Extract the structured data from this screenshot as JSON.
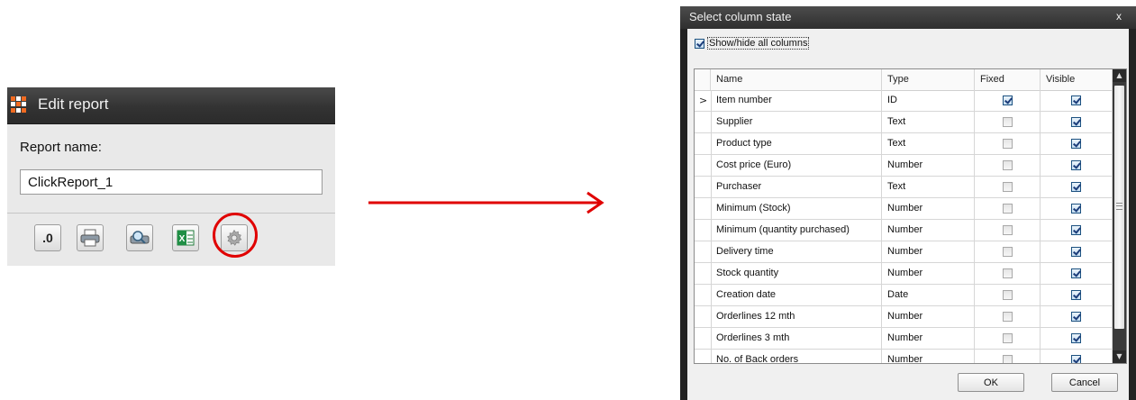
{
  "edit_report": {
    "title": "Edit report",
    "report_name_label": "Report name:",
    "report_name_value": "ClickReport_1",
    "toolbar": {
      "decimal_label": ".0",
      "icons": [
        "decimal-icon",
        "print-icon",
        "preview-icon",
        "excel-icon",
        "gear-icon"
      ],
      "highlighted": "gear-icon",
      "highlight_color": "#e00000"
    },
    "app_icon_colors": [
      "#f26b21",
      "#ffffff",
      "#f26b21",
      "#ffffff",
      "#f26b21",
      "#ffffff",
      "#f26b21",
      "#ffffff",
      "#f26b21"
    ]
  },
  "arrow": {
    "color": "#e00000",
    "icon": "right-arrow-icon"
  },
  "dialog": {
    "title": "Select column state",
    "close_label": "x",
    "show_hide_all": {
      "label": "Show/hide all columns",
      "checked": true
    },
    "columns": {
      "name": "Name",
      "type": "Type",
      "fixed": "Fixed",
      "visible": "Visible"
    },
    "rows": [
      {
        "name": "Item number",
        "type": "ID",
        "fixed": true,
        "visible": true,
        "current": true
      },
      {
        "name": "Supplier",
        "type": "Text",
        "fixed": false,
        "visible": true
      },
      {
        "name": "Product type",
        "type": "Text",
        "fixed": false,
        "visible": true
      },
      {
        "name": "Cost price (Euro)",
        "type": "Number",
        "fixed": false,
        "visible": true
      },
      {
        "name": "Purchaser",
        "type": "Text",
        "fixed": false,
        "visible": true
      },
      {
        "name": "Minimum (Stock)",
        "type": "Number",
        "fixed": false,
        "visible": true
      },
      {
        "name": "Minimum  (quantity purchased)",
        "type": "Number",
        "fixed": false,
        "visible": true
      },
      {
        "name": "Delivery time",
        "type": "Number",
        "fixed": false,
        "visible": true
      },
      {
        "name": "Stock quantity",
        "type": "Number",
        "fixed": false,
        "visible": true
      },
      {
        "name": "Creation date",
        "type": "Date",
        "fixed": false,
        "visible": true
      },
      {
        "name": "Orderlines 12 mth",
        "type": "Number",
        "fixed": false,
        "visible": true
      },
      {
        "name": "Orderlines 3 mth",
        "type": "Number",
        "fixed": false,
        "visible": true
      },
      {
        "name": "No. of Back orders",
        "type": "Number",
        "fixed": false,
        "visible": true
      }
    ],
    "current_row_marker": ">",
    "ok_label": "OK",
    "cancel_label": "Cancel"
  }
}
